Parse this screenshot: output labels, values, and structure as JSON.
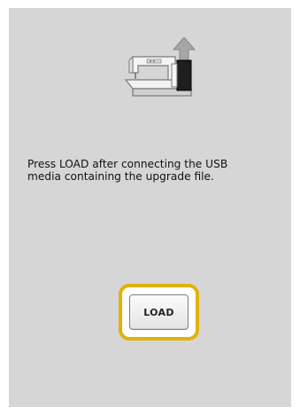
{
  "screen": {
    "icon": "sewing-machine-upgrade-icon",
    "message": "Press LOAD after connecting the USB\nmedia containing the upgrade file."
  },
  "load_button": {
    "label": "LOAD",
    "highlight_color": "#e0b20a"
  }
}
